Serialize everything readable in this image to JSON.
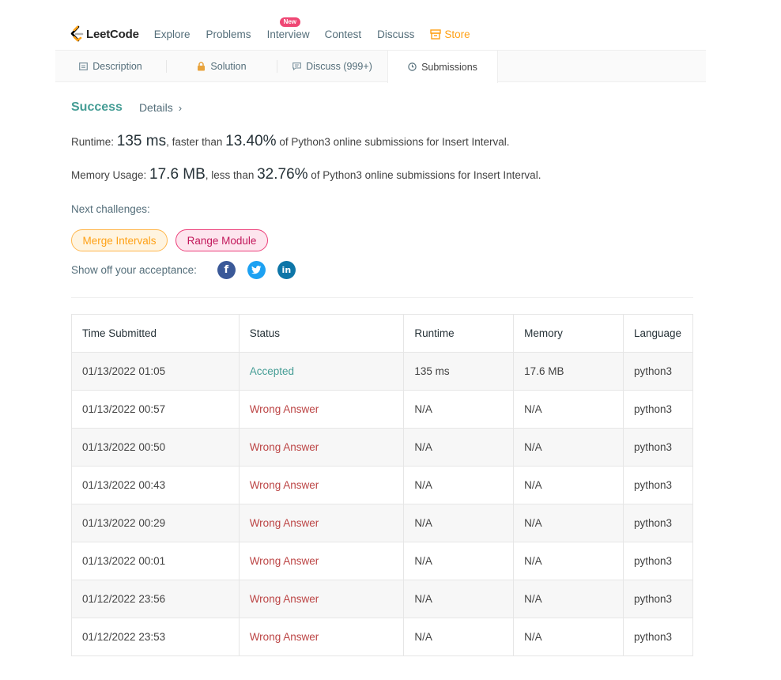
{
  "nav": {
    "logo_text": "LeetCode",
    "items": [
      "Explore",
      "Problems",
      "Interview",
      "Contest",
      "Discuss"
    ],
    "interview_badge": "New",
    "store": "Store"
  },
  "tabs": {
    "description": "Description",
    "solution": "Solution",
    "discuss": "Discuss (999+)",
    "submissions": "Submissions"
  },
  "result": {
    "status": "Success",
    "details": "Details",
    "details_chevron": "›",
    "runtime_label": "Runtime: ",
    "runtime_value": "135 ms",
    "runtime_mid": ", faster than ",
    "runtime_pct": "13.40%",
    "runtime_tail": " of Python3 online submissions for Insert Interval.",
    "memory_label": "Memory Usage: ",
    "memory_value": "17.6 MB",
    "memory_mid": ", less than ",
    "memory_pct": "32.76%",
    "memory_tail": " of Python3 online submissions for Insert Interval.",
    "next_label": "Next challenges:",
    "challenges": [
      "Merge Intervals",
      "Range Module"
    ],
    "share_label": "Show off your acceptance:",
    "social": {
      "facebook": "f",
      "twitter": "t",
      "linkedin": "in"
    }
  },
  "table": {
    "headers": [
      "Time Submitted",
      "Status",
      "Runtime",
      "Memory",
      "Language"
    ],
    "rows": [
      [
        "01/13/2022 01:05",
        "Accepted",
        "135 ms",
        "17.6 MB",
        "python3"
      ],
      [
        "01/13/2022 00:57",
        "Wrong Answer",
        "N/A",
        "N/A",
        "python3"
      ],
      [
        "01/13/2022 00:50",
        "Wrong Answer",
        "N/A",
        "N/A",
        "python3"
      ],
      [
        "01/13/2022 00:43",
        "Wrong Answer",
        "N/A",
        "N/A",
        "python3"
      ],
      [
        "01/13/2022 00:29",
        "Wrong Answer",
        "N/A",
        "N/A",
        "python3"
      ],
      [
        "01/13/2022 00:01",
        "Wrong Answer",
        "N/A",
        "N/A",
        "python3"
      ],
      [
        "01/12/2022 23:56",
        "Wrong Answer",
        "N/A",
        "N/A",
        "python3"
      ],
      [
        "01/12/2022 23:53",
        "Wrong Answer",
        "N/A",
        "N/A",
        "python3"
      ]
    ]
  },
  "colors": {
    "accent": "#ffa116",
    "accepted": "#459d95",
    "wrong": "#bc4545",
    "hard": "#c2185b"
  },
  "icons": {
    "description": "document-icon",
    "solution": "lock-icon",
    "discuss": "comment-icon",
    "submissions": "clock-icon",
    "store": "store-icon"
  }
}
